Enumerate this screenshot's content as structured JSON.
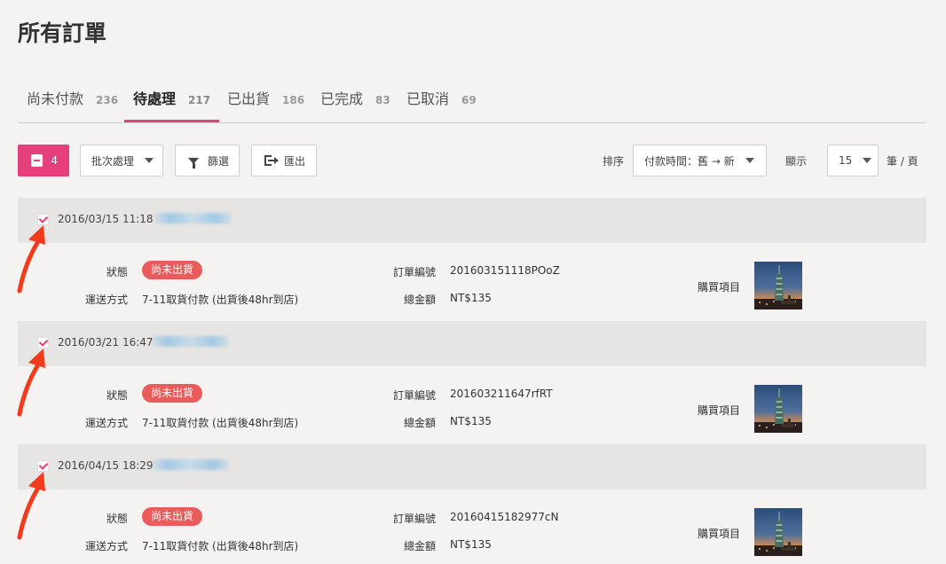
{
  "page": {
    "title": "所有訂單"
  },
  "tabs": [
    {
      "label": "尚未付款",
      "count": "236",
      "active": false
    },
    {
      "label": "待處理",
      "count": "217",
      "active": true
    },
    {
      "label": "已出貨",
      "count": "186",
      "active": false
    },
    {
      "label": "已完成",
      "count": "83",
      "active": false
    },
    {
      "label": "已取消",
      "count": "69",
      "active": false
    }
  ],
  "toolbar": {
    "selected_count": "4",
    "batch_label": "批次處理",
    "filter_label": "篩選",
    "export_label": "匯出",
    "sort_label": "排序",
    "sort_value": "付款時間：舊 → 新",
    "display_label": "顯示",
    "per_page_value": "15",
    "per_page_unit": "筆 / 頁"
  },
  "field_labels": {
    "status": "狀態",
    "shipping": "運送方式",
    "order_no": "訂單編號",
    "total": "總金額",
    "items": "購買項目"
  },
  "orders": [
    {
      "datetime": "2016/03/15 11:18",
      "status": "尚未出貨",
      "shipping": "7-11取貨付款 (出貨後48hr到店)",
      "order_no": "201603151118POoZ",
      "total": "NT$135",
      "checked": true
    },
    {
      "datetime": "2016/03/21 16:47",
      "status": "尚未出貨",
      "shipping": "7-11取貨付款 (出貨後48hr到店)",
      "order_no": "201603211647rfRT",
      "total": "NT$135",
      "checked": true
    },
    {
      "datetime": "2016/04/15 18:29",
      "status": "尚未出貨",
      "shipping": "7-11取貨付款 (出貨後48hr到店)",
      "order_no": "20160415182977cN",
      "total": "NT$135",
      "checked": true
    }
  ],
  "colors": {
    "accent": "#e5407b",
    "status_badge": "#ea5b5b",
    "annotation_arrow": "#f23a1c"
  }
}
